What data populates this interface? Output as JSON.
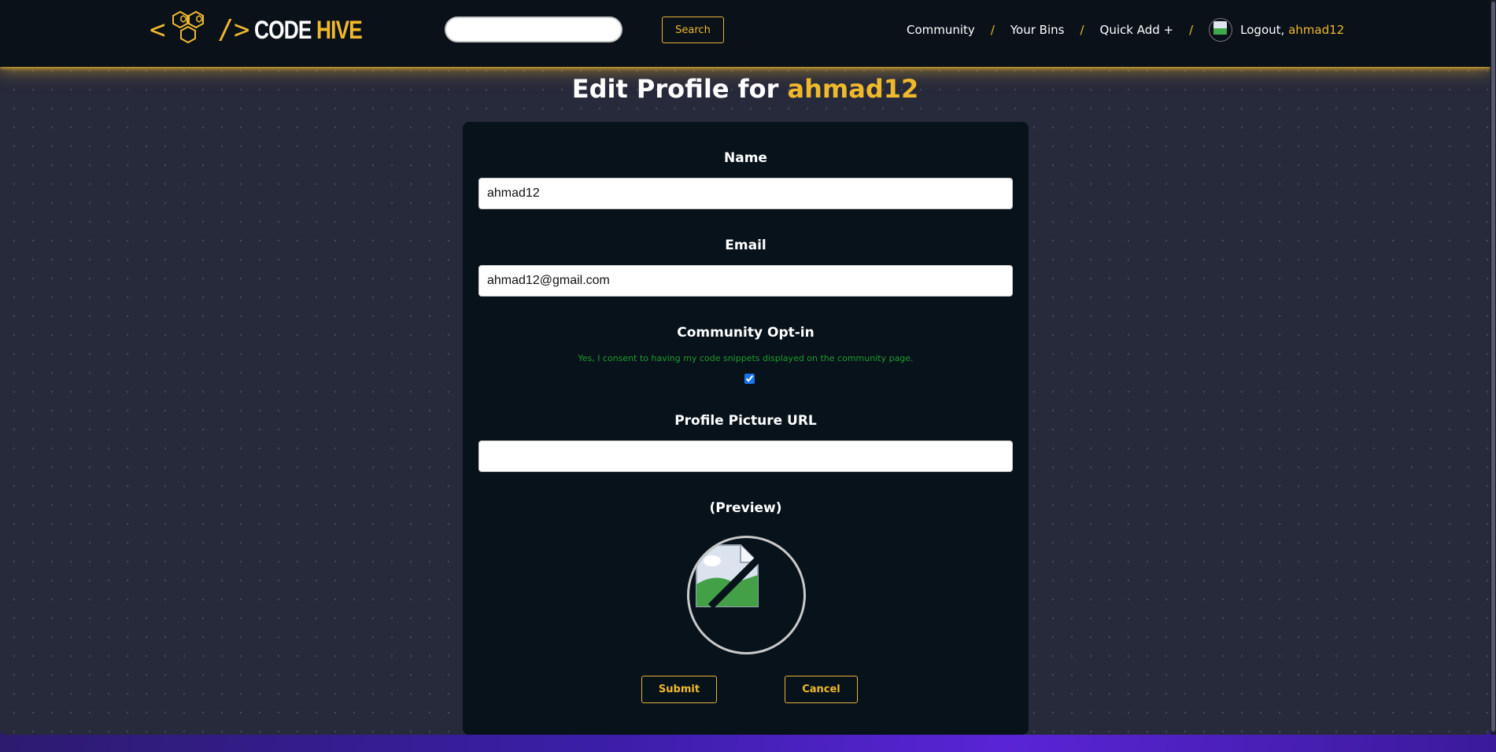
{
  "colors": {
    "accent": "#f0b92c",
    "navbar_bg": "#0a1119",
    "card_bg": "#07121b",
    "consent_text": "#1f9c2b",
    "page_bg": "#272a3b"
  },
  "header": {
    "logo": {
      "open_bracket": "<",
      "close_bracket": "/>",
      "word1": "CODE",
      "word2": "HIVE",
      "icon": "hexagon-cluster-icon"
    },
    "search": {
      "value": "",
      "button_label": "Search"
    },
    "nav": {
      "community": "Community",
      "your_bins": "Your Bins",
      "quick_add": "Quick Add +",
      "separator": "/",
      "logout_label": "Logout,",
      "username": "ahmad12"
    }
  },
  "page": {
    "title_prefix": "Edit Profile for",
    "title_user": "ahmad12"
  },
  "form": {
    "name": {
      "label": "Name",
      "value": "ahmad12"
    },
    "email": {
      "label": "Email",
      "value": "ahmad12@gmail.com"
    },
    "community_opt_in": {
      "label": "Community Opt-in",
      "consent_text": "Yes, I consent to having my code snippets displayed on the community page.",
      "checked": true
    },
    "profile_picture_url": {
      "label": "Profile Picture URL",
      "value": ""
    },
    "preview_label": "(Preview)",
    "submit_label": "Submit",
    "cancel_label": "Cancel"
  }
}
